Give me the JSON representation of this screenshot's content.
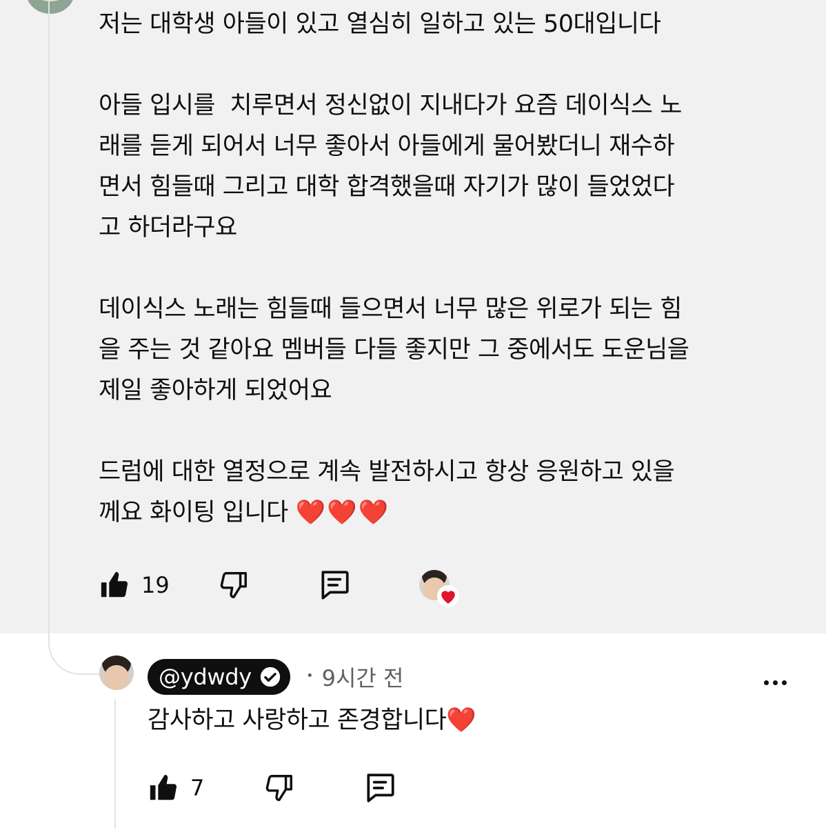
{
  "comment": {
    "paragraphs": [
      "저는 대학생 아들이 있고 열심히 일하고 있는 50대입니다",
      "아들 입시를  치루면서 정신없이 지내다가 요즘 데이식스 노\n래를 듣게 되어서 너무 좋아서 아들에게 물어봤더니 재수하\n면서 힘들때 그리고 대학 합격했을때 자기가 많이 들었었다\n고 하더라구요",
      "데이식스 노래는 힘들때 들으면서 너무 많은 위로가 되는 힘\n을 주는 것 같아요 멤버들 다들 좋지만 그 중에서도 도운님을\n제일 좋아하게 되었어요",
      "드럼에 대한 열정으로 계속 발전하시고 항상 응원하고 있을\n께요 화이팅 입니다 "
    ],
    "hearts": "❤️❤️❤️",
    "like_count": "19",
    "icons": [
      "thumbs-up-icon",
      "thumbs-down-icon",
      "reply-icon",
      "creator-heart-icon"
    ]
  },
  "reply": {
    "author": "@ydwdy",
    "time": "9시간 전",
    "dot": "•",
    "text": "감사하고 사랑하고 존경합니다",
    "heart": "❤️",
    "like_count": "7",
    "icons": [
      "verified-check-icon",
      "more-options-icon",
      "thumbs-up-icon",
      "thumbs-down-icon",
      "reply-icon"
    ]
  },
  "colors": {
    "highlight_bg": "#f1f1f1",
    "heart_red": "#e0162b",
    "meta_gray": "#606060"
  }
}
